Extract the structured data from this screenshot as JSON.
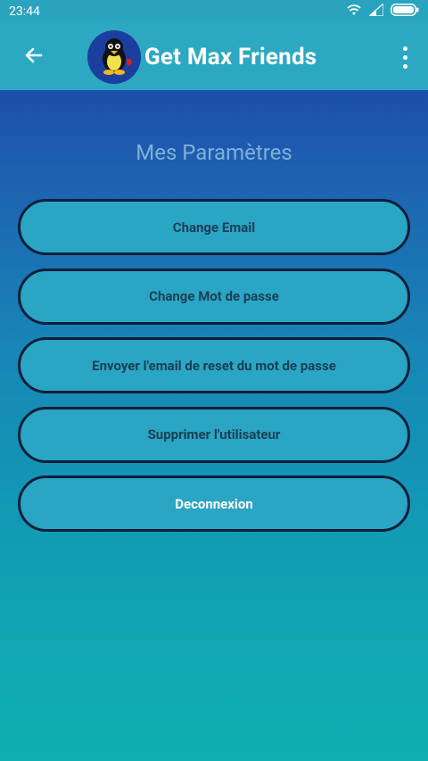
{
  "status_bar": {
    "time": "23:44"
  },
  "app_bar": {
    "title": "Get Max Friends",
    "back_icon": "arrow-left-icon",
    "menu_icon": "more-vert-icon"
  },
  "page": {
    "section_title": "Mes Paramètres"
  },
  "settings": {
    "items": [
      {
        "label": "Change Email"
      },
      {
        "label": "Change Mot de passe"
      },
      {
        "label": "Envoyer l'email de reset du mot de passe"
      },
      {
        "label": "Supprimer l'utilisateur"
      },
      {
        "label": "Deconnexion"
      }
    ]
  },
  "colors": {
    "app_bar": "#2ca8c2",
    "button_fill": "#2aa5c4",
    "button_border": "#0b1f3a",
    "section_title": "#7fb0d6"
  }
}
